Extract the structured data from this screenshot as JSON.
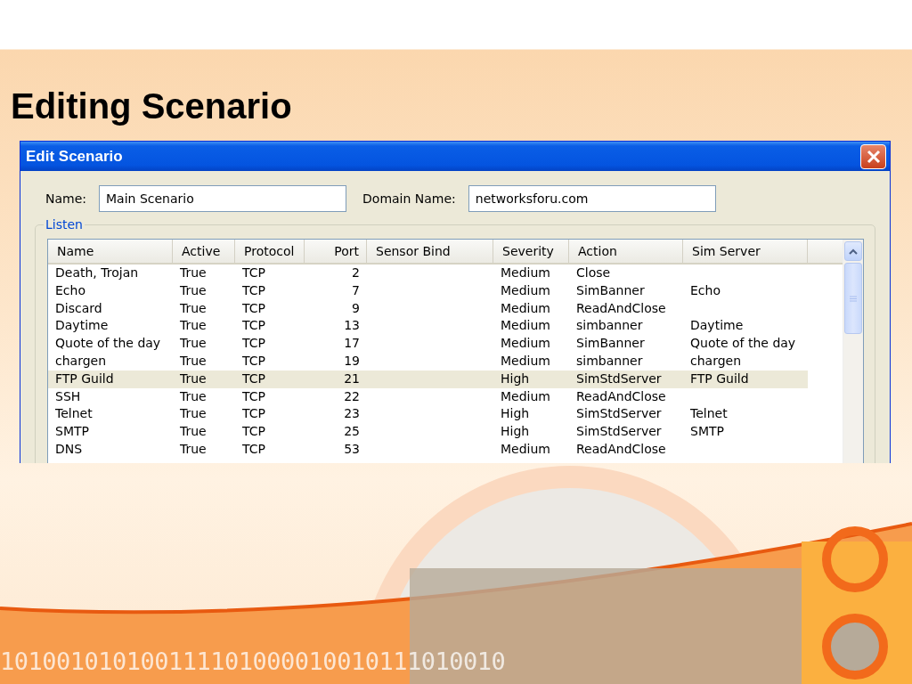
{
  "slide_title": "Editing Scenario",
  "window": {
    "title": "Edit Scenario"
  },
  "name_field": {
    "label": "Name:",
    "value": "Main Scenario"
  },
  "domain_field": {
    "label": "Domain Name:",
    "value": "networksforu.com"
  },
  "group": {
    "title": "Listen"
  },
  "table": {
    "columns": [
      "Name",
      "Active",
      "Protocol",
      "Port",
      "Sensor Bind",
      "Severity",
      "Action",
      "Sim Server"
    ],
    "rows": [
      {
        "selected": false,
        "cells": [
          "Death, Trojan",
          "True",
          "TCP",
          "2",
          "",
          "Medium",
          "Close",
          ""
        ]
      },
      {
        "selected": false,
        "cells": [
          "Echo",
          "True",
          "TCP",
          "7",
          "",
          "Medium",
          "SimBanner",
          "Echo"
        ]
      },
      {
        "selected": false,
        "cells": [
          "Discard",
          "True",
          "TCP",
          "9",
          "",
          "Medium",
          "ReadAndClose",
          ""
        ]
      },
      {
        "selected": false,
        "cells": [
          "Daytime",
          "True",
          "TCP",
          "13",
          "",
          "Medium",
          "simbanner",
          "Daytime"
        ]
      },
      {
        "selected": false,
        "cells": [
          "Quote of the day",
          "True",
          "TCP",
          "17",
          "",
          "Medium",
          "SimBanner",
          "Quote of the day"
        ]
      },
      {
        "selected": false,
        "cells": [
          "chargen",
          "True",
          "TCP",
          "19",
          "",
          "Medium",
          "simbanner",
          "chargen"
        ]
      },
      {
        "selected": true,
        "cells": [
          "FTP Guild",
          "True",
          "TCP",
          "21",
          "",
          "High",
          "SimStdServer",
          "FTP Guild"
        ]
      },
      {
        "selected": false,
        "cells": [
          "SSH",
          "True",
          "TCP",
          "22",
          "",
          "Medium",
          "ReadAndClose",
          ""
        ]
      },
      {
        "selected": false,
        "cells": [
          "Telnet",
          "True",
          "TCP",
          "23",
          "",
          "High",
          "SimStdServer",
          "Telnet"
        ]
      },
      {
        "selected": false,
        "cells": [
          "SMTP",
          "True",
          "TCP",
          "25",
          "",
          "High",
          "SimStdServer",
          "SMTP"
        ]
      },
      {
        "selected": false,
        "cells": [
          "DNS",
          "True",
          "TCP",
          "53",
          "",
          "Medium",
          "ReadAndClose",
          ""
        ]
      }
    ]
  },
  "banner_digits": "101001010100111101000010010111010010"
}
